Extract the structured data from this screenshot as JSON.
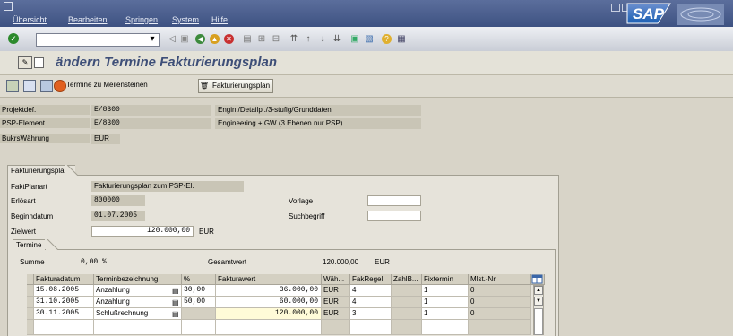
{
  "menu": [
    "Übersicht",
    "Bearbeiten",
    "Springen",
    "System",
    "Hilfe"
  ],
  "logo_text": "SAP",
  "title": "ändern Termine Fakturierungsplan",
  "app_toolbar": {
    "btn_milestones": "Termine zu Meilensteinen",
    "btn_billing_plan": "Fakturierungsplan"
  },
  "header": {
    "projektdef_label": "Projektdef.",
    "projektdef_value": "E/8300",
    "projektdef_text": "Engin./Detailpl./3-stufig/Grunddaten",
    "psp_label": "PSP-Element",
    "psp_value": "E/8300",
    "psp_text": "Engineering + GW (3 Ebenen nur PSP)",
    "bukrs_label": "BukrsWährung",
    "bukrs_value": "EUR"
  },
  "billing": {
    "tab_label": "Fakturierungsplan",
    "faktplanart_label": "FaktPlanart",
    "faktplanart_value": "Fakturierungsplan zum PSP-El.",
    "erloesart_label": "Erlösart",
    "erloesart_value": "800000",
    "vorlage_label": "Vorlage",
    "beginndatum_label": "Beginndatum",
    "beginndatum_value": "01.07.2005",
    "suchbegriff_label": "Suchbegriff",
    "zielwert_label": "Zielwert",
    "zielwert_value": "120.000,00",
    "zielwert_currency": "EUR"
  },
  "termine": {
    "tab_label": "Termine",
    "summe_label": "Summe",
    "summe_value": "0,00 %",
    "gesamtwert_label": "Gesamtwert",
    "gesamtwert_value": "120.000,00",
    "gesamtwert_currency": "EUR"
  },
  "table": {
    "columns": [
      "Fakturadatum",
      "Terminbezeichnung",
      "%",
      "Fakturawert",
      "Wäh...",
      "FakRegel",
      "ZahlB...",
      "Fixtermin",
      "Mlst.-Nr."
    ],
    "rows": [
      {
        "datum": "15.08.2005",
        "bez": "Anzahlung",
        "pct": "30,00",
        "wert": "36.000,00",
        "waeh": "EUR",
        "regel": "4",
        "zahlb": "",
        "fix": "1",
        "mlst": "0"
      },
      {
        "datum": "31.10.2005",
        "bez": "Anzahlung",
        "pct": "50,00",
        "wert": "60.000,00",
        "waeh": "EUR",
        "regel": "4",
        "zahlb": "",
        "fix": "1",
        "mlst": "0"
      },
      {
        "datum": "30.11.2005",
        "bez": "Schlußrechnung",
        "pct": "",
        "wert": "120.000,00",
        "waeh": "EUR",
        "regel": "3",
        "zahlb": "",
        "fix": "1",
        "mlst": "0"
      }
    ]
  },
  "colors": {
    "menubar": "#4a5d8e",
    "title": "#3e4f78",
    "logo_bg": "#1a5fb4"
  }
}
